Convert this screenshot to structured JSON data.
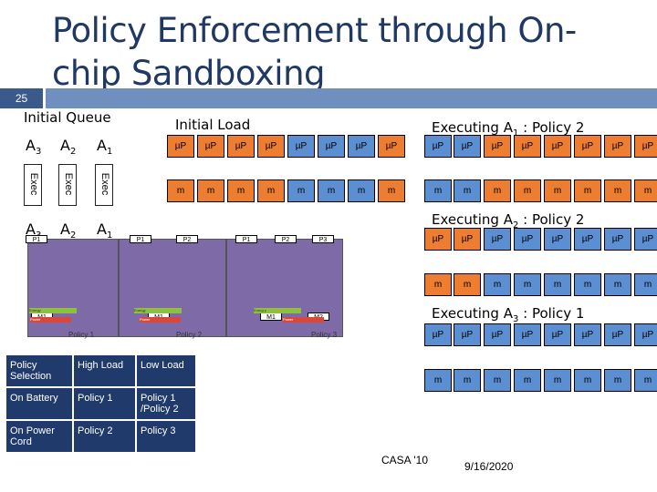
{
  "slide": {
    "number": "25",
    "title": "Policy Enforcement through On-chip Sandboxing",
    "colors": {
      "title": "#1f3864",
      "accent_bar": "#6f8fbf",
      "orange": "#ed7d31",
      "blue": "#5b8fd1",
      "purple": "#7e6aa6",
      "table_bg": "#1f3a6b",
      "green": "#8fbf3f",
      "red": "#d9483b"
    }
  },
  "queue": {
    "heading": "Initial Queue",
    "top_apps": [
      {
        "base": "A",
        "sub": "3"
      },
      {
        "base": "A",
        "sub": "2"
      },
      {
        "base": "A",
        "sub": "1"
      }
    ],
    "exec_label": "Exec",
    "bottom_apps": [
      {
        "base": "A",
        "sub": "3"
      },
      {
        "base": "A",
        "sub": "2"
      },
      {
        "base": "A",
        "sub": "1"
      }
    ]
  },
  "initial_load": {
    "heading": "Initial Load",
    "up_label": "µP",
    "mem_label": "m"
  },
  "executing": [
    {
      "heading_prefix": "Executing A",
      "sub": "1",
      "heading_suffix": " : Policy 2"
    },
    {
      "heading_prefix": "Executing A",
      "sub": "2",
      "heading_suffix": " : Policy 2"
    },
    {
      "heading_prefix": "Executing A",
      "sub": "3",
      "heading_suffix": " : Policy 1"
    }
  ],
  "chips": {
    "chip1": {
      "p": [
        "P1"
      ],
      "m": [
        "M1"
      ],
      "green": "Energy",
      "red": "Power",
      "policy": "Policy 1"
    },
    "chip2": {
      "p": [
        "P1",
        "P2"
      ],
      "m": [
        "M1"
      ],
      "green": "Energy",
      "red": "Power",
      "policy": "Policy 2"
    },
    "chip3": {
      "p": [
        "P1",
        "P2",
        "P3"
      ],
      "m": [
        "M1",
        "M2"
      ],
      "green": "Energ y",
      "red": "Power",
      "policy": "Policy 3"
    }
  },
  "policy_table": {
    "rows": [
      [
        "Policy Selection",
        "High Load",
        "Low Load"
      ],
      [
        "On Battery",
        "Policy 1",
        "Policy 1 /Policy 2"
      ],
      [
        "On Power Cord",
        "Policy 2",
        "Policy 3"
      ]
    ]
  },
  "footer": {
    "venue": "CASA '10",
    "date": "9/16/2020"
  }
}
